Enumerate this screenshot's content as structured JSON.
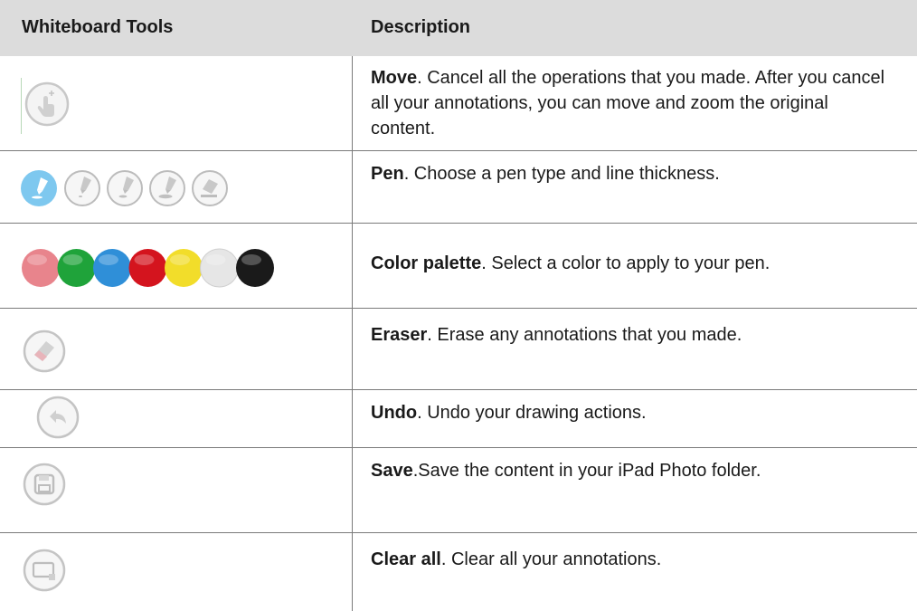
{
  "header": {
    "col_tools": "Whiteboard Tools",
    "col_description": "Description"
  },
  "rows": [
    {
      "name": "Move",
      "text": ". Cancel all the operations that you made. After you cancel all your annotations, you can move and zoom the original content.",
      "icon": "move-hand-icon"
    },
    {
      "name": "Pen",
      "text": ". Choose a pen type and line thickness.",
      "icons": [
        "pen-fine-icon",
        "pen-thin-icon",
        "pen-medium-icon",
        "pen-thick-icon",
        "highlighter-icon"
      ]
    },
    {
      "name": "Color palette",
      "text": ". Select a color to apply to your pen.",
      "colors": [
        "#e8848c",
        "#1fa33a",
        "#2f8fd8",
        "#d4141e",
        "#f2dd2a",
        "#e6e6e6",
        "#1a1a1a"
      ]
    },
    {
      "name": "Eraser",
      "text": ". Erase any annotations that you made.",
      "icon": "eraser-icon"
    },
    {
      "name": "Undo",
      "text": ". Undo your drawing actions.",
      "icon": "undo-icon"
    },
    {
      "name": "Save",
      "text": ".Save the content in your iPad Photo folder.",
      "icon": "save-icon"
    },
    {
      "name": "Clear all",
      "text": ". Clear all your annotations.",
      "icon": "clear-all-icon"
    }
  ]
}
